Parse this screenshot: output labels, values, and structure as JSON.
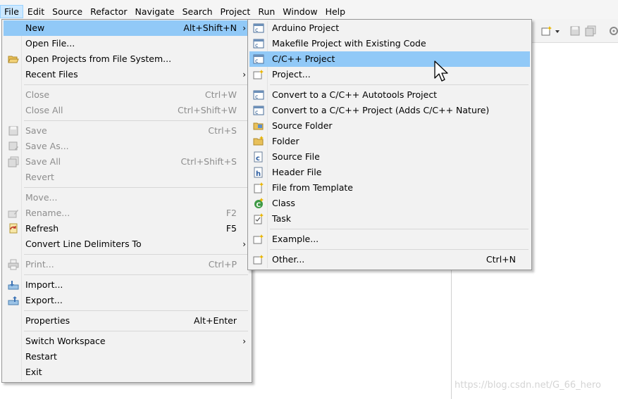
{
  "menubar": {
    "items": [
      "File",
      "Edit",
      "Source",
      "Refactor",
      "Navigate",
      "Search",
      "Project",
      "Run",
      "Window",
      "Help"
    ]
  },
  "file_menu": {
    "new": {
      "label": "New",
      "accel": "Alt+Shift+N"
    },
    "open_file": {
      "label": "Open File..."
    },
    "open_projects": {
      "label": "Open Projects from File System..."
    },
    "recent_files": {
      "label": "Recent Files"
    },
    "close": {
      "label": "Close",
      "accel": "Ctrl+W"
    },
    "close_all": {
      "label": "Close All",
      "accel": "Ctrl+Shift+W"
    },
    "save": {
      "label": "Save",
      "accel": "Ctrl+S"
    },
    "save_as": {
      "label": "Save As..."
    },
    "save_all": {
      "label": "Save All",
      "accel": "Ctrl+Shift+S"
    },
    "revert": {
      "label": "Revert"
    },
    "move": {
      "label": "Move..."
    },
    "rename": {
      "label": "Rename...",
      "accel": "F2"
    },
    "refresh": {
      "label": "Refresh",
      "accel": "F5"
    },
    "convert_line": {
      "label": "Convert Line Delimiters To"
    },
    "print": {
      "label": "Print...",
      "accel": "Ctrl+P"
    },
    "import": {
      "label": "Import..."
    },
    "export": {
      "label": "Export..."
    },
    "properties": {
      "label": "Properties",
      "accel": "Alt+Enter"
    },
    "switch_workspace": {
      "label": "Switch Workspace"
    },
    "restart": {
      "label": "Restart"
    },
    "exit": {
      "label": "Exit"
    }
  },
  "new_menu": {
    "arduino": {
      "label": "Arduino Project"
    },
    "makefile": {
      "label": "Makefile Project with Existing Code"
    },
    "cpp_project": {
      "label": "C/C++ Project"
    },
    "project": {
      "label": "Project..."
    },
    "autotools": {
      "label": "Convert to a C/C++ Autotools Project"
    },
    "convert_nature": {
      "label": "Convert to a C/C++ Project (Adds C/C++ Nature)"
    },
    "source_folder": {
      "label": "Source Folder"
    },
    "folder": {
      "label": "Folder"
    },
    "source_file": {
      "label": "Source File"
    },
    "header_file": {
      "label": "Header File"
    },
    "file_from_template": {
      "label": "File from Template"
    },
    "class": {
      "label": "Class"
    },
    "task": {
      "label": "Task"
    },
    "example": {
      "label": "Example..."
    },
    "other": {
      "label": "Other...",
      "accel": "Ctrl+N"
    }
  },
  "watermark": "https://blog.csdn.net/G_66_hero",
  "colors": {
    "highlight": "#91c9f7",
    "menu_bg": "#f2f2f2",
    "menubar_active": "#cce8ff",
    "disabled_text": "#8d8d8d"
  }
}
